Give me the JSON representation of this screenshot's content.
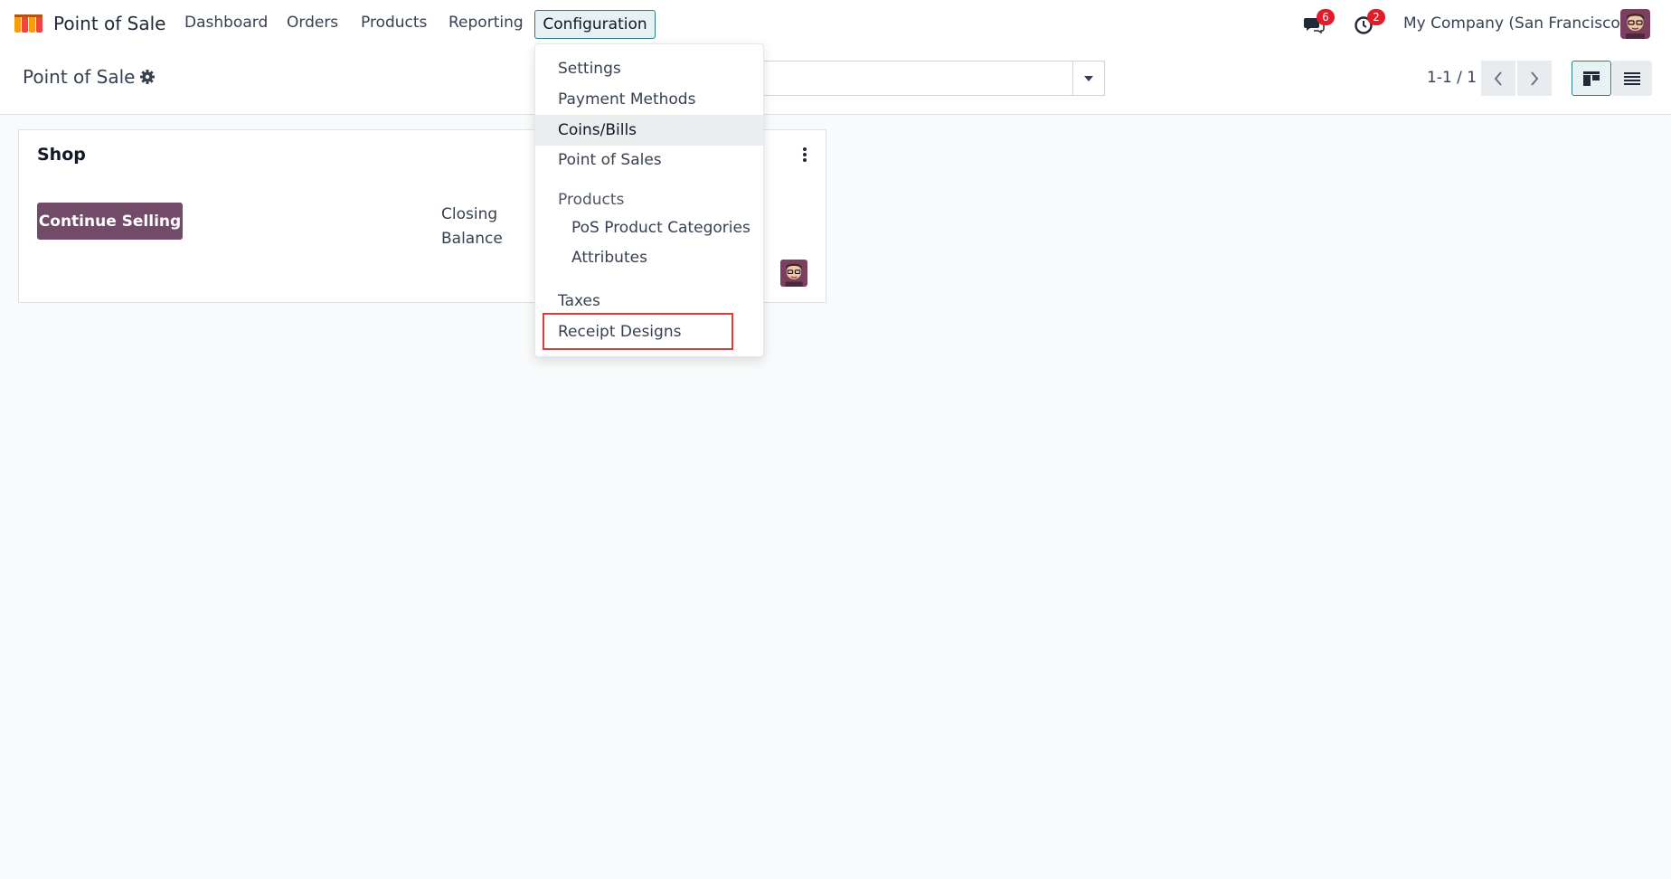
{
  "navbar": {
    "app_name": "Point of Sale",
    "menu": {
      "dashboard": "Dashboard",
      "orders": "Orders",
      "products": "Products",
      "reporting": "Reporting",
      "configuration": "Configuration"
    },
    "messages_badge": "6",
    "activities_badge": "2",
    "company": "My Company (San Francisco)"
  },
  "control_panel": {
    "breadcrumb": "Point of Sale",
    "pager_value": "1-1 / 1"
  },
  "card": {
    "title": "Shop",
    "continue_button": "Continue Selling",
    "closing_label": "Closing Balance"
  },
  "dropdown": {
    "items": {
      "settings": "Settings",
      "payment_methods": "Payment Methods",
      "coins_bills": "Coins/Bills",
      "point_of_sales": "Point of Sales",
      "products_header": "Products",
      "pos_product_categories": "PoS Product Categories",
      "attributes": "Attributes",
      "taxes": "Taxes",
      "receipt_designs": "Receipt Designs"
    }
  },
  "colors": {
    "brand": "#714b67",
    "accent": "#2f7c86",
    "highlight": "#e53935",
    "badge": "#e11d2b"
  },
  "icons": [
    "app-logo-icon",
    "chat-icon",
    "clock-icon",
    "gear-icon",
    "caret-down-icon",
    "chevron-left-icon",
    "chevron-right-icon",
    "kanban-view-icon",
    "list-view-icon",
    "kebab-menu-icon"
  ]
}
